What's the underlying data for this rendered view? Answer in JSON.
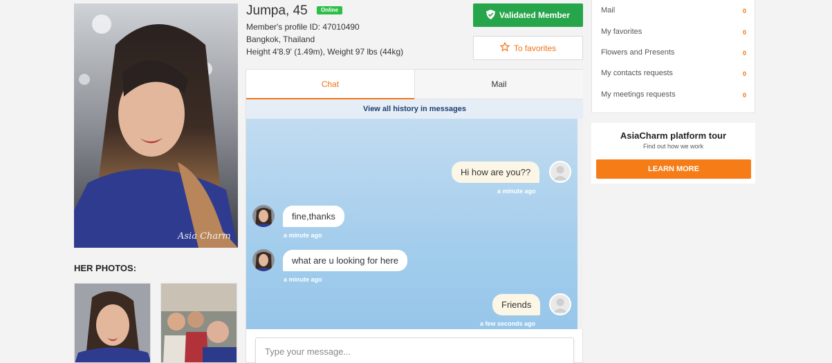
{
  "profile": {
    "name": "Jumpa, 45",
    "status": "Online",
    "profile_id": "Member's profile ID: 47010490",
    "location": "Bangkok, Thailand",
    "body": "Height 4'8.9' (1.49m), Weight 97 lbs (44kg)",
    "photo_watermark": "Asia Charm",
    "photos_heading": "HER PHOTOS:"
  },
  "actions": {
    "validated_label": "Validated Member",
    "favorites_label": "To favorites"
  },
  "chat": {
    "tabs": [
      {
        "label": "Chat",
        "active": true
      },
      {
        "label": "Mail",
        "active": false
      }
    ],
    "history_link": "View all history in messages",
    "messages": [
      {
        "direction": "out",
        "text": "Hi how are you??",
        "time": "a minute ago"
      },
      {
        "direction": "in",
        "text": "fine,thanks",
        "time": "a minute ago"
      },
      {
        "direction": "in",
        "text": "what are u looking for here",
        "time": "a minute ago"
      },
      {
        "direction": "out",
        "text": "Friends",
        "time": "a few seconds ago"
      }
    ],
    "input_placeholder": "Type your message..."
  },
  "sidebar": {
    "items": [
      {
        "label": "Mail",
        "count": "0"
      },
      {
        "label": "My favorites",
        "count": "0"
      },
      {
        "label": "Flowers and Presents",
        "count": "0"
      },
      {
        "label": "My contacts requests",
        "count": "0"
      },
      {
        "label": "My meetings requests",
        "count": "0"
      }
    ],
    "tour": {
      "title": "AsiaCharm platform tour",
      "subtitle": "Find out how we work",
      "button": "LEARN MORE"
    }
  },
  "colors": {
    "accent_orange": "#f07416",
    "validated_green": "#27a54b",
    "online_green": "#2dbe4a",
    "chat_background": "#a3cdec"
  }
}
